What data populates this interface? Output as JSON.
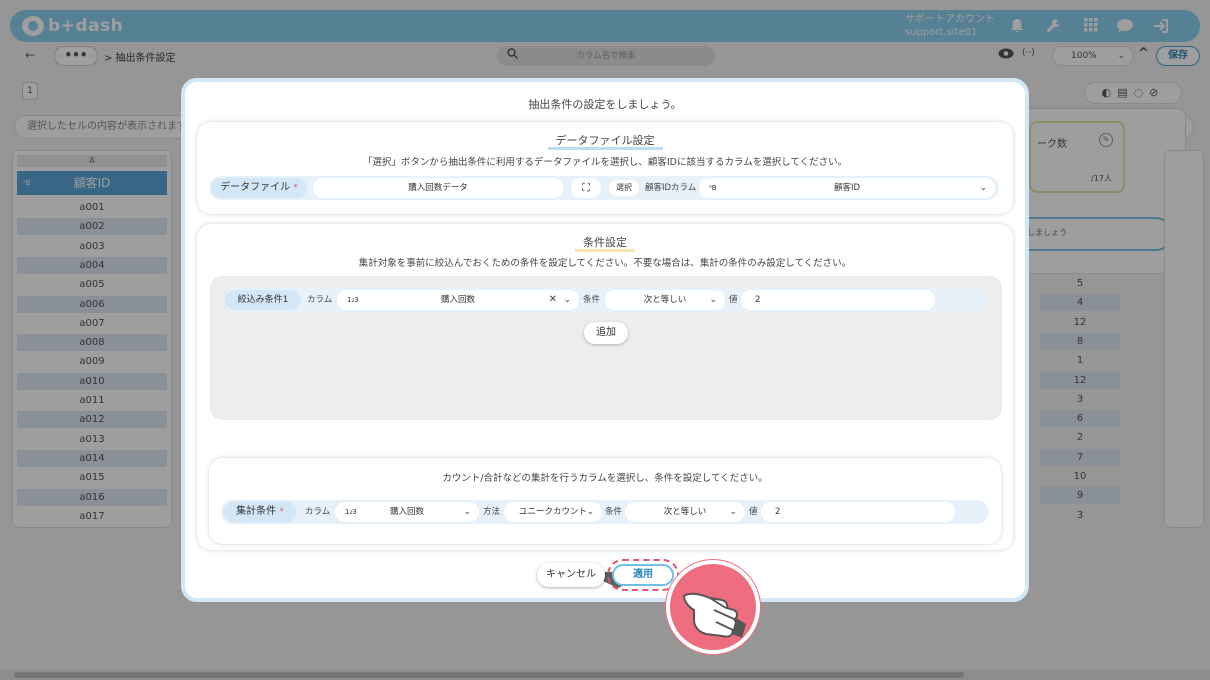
{
  "app": {
    "logo_text": "b+dash",
    "account_label": "サポートアカウント",
    "account_id": "support.site01",
    "breadcrumb": "> 抽出条件設定",
    "search_placeholder": "カラム名で検索",
    "zoom": "100%",
    "save_label": "保存",
    "sheet_tab": "1",
    "cell_info_placeholder": "選択したセルの内容が表示されます。",
    "column_letter": "A",
    "column_name": "顧客ID",
    "column_type_icon": "ᵃB",
    "rows": [
      "a001",
      "a002",
      "a003",
      "a004",
      "a005",
      "a006",
      "a007",
      "a008",
      "a009",
      "a010",
      "a011",
      "a012",
      "a013",
      "a014",
      "a015",
      "a016",
      "a017"
    ],
    "right_values": [
      "5",
      "4",
      "12",
      "8",
      "1",
      "12",
      "3",
      "6",
      "2",
      "7",
      "10",
      "9",
      "3"
    ],
    "side_card_title": "ーク数",
    "side_card_count": "/17人",
    "side_input_text": "しましょう"
  },
  "modal": {
    "title": "抽出条件の設定をしましょう。",
    "data_file": {
      "title": "データファイル設定",
      "description": "「選択」ボタンから抽出条件に利用するデータファイルを選択し、顧客IDに該当するカラムを選択してください。",
      "label": "データファイル",
      "value": "購入回数データ",
      "select_label": "選択",
      "customer_id_column_label": "顧客IDカラム",
      "customer_id_column_value": "顧客ID",
      "customer_id_type_icon": "ᵃB"
    },
    "conditions": {
      "title": "条件設定",
      "description": "集計対象を事前に絞込んでおくための条件を設定してください。不要な場合は、集計の条件のみ設定してください。",
      "filter": {
        "label": "絞込み条件1",
        "column_label": "カラム",
        "column_value": "購入回数",
        "column_type_icon": "1₂3",
        "condition_label": "条件",
        "condition_value": "次と等しい",
        "value_label": "値",
        "value": "2"
      },
      "add_label": "追加"
    },
    "aggregate": {
      "description": "カウント/合計などの集計を行うカラムを選択し、条件を設定してください。",
      "label": "集計条件",
      "column_label": "カラム",
      "column_value": "購入回数",
      "column_type_icon": "1₂3",
      "method_label": "方法",
      "method_value": "ユニークカウント",
      "condition_label": "条件",
      "condition_value": "次と等しい",
      "value_label": "値",
      "value": "2"
    },
    "cancel_label": "キャンセル",
    "apply_label": "適用"
  },
  "colors": {
    "brand": "#8ccfee",
    "accent": "#4aa3d6",
    "highlight_ring": "#e0566b",
    "pointer_bg": "#ee6e80"
  },
  "icons": [
    "bell-icon",
    "wrench-icon",
    "grid-icon",
    "chat-icon",
    "logout-icon",
    "search-icon",
    "eye-icon",
    "code-icon",
    "chevron-up-icon",
    "expand-icon",
    "pointer-hand-icon"
  ]
}
